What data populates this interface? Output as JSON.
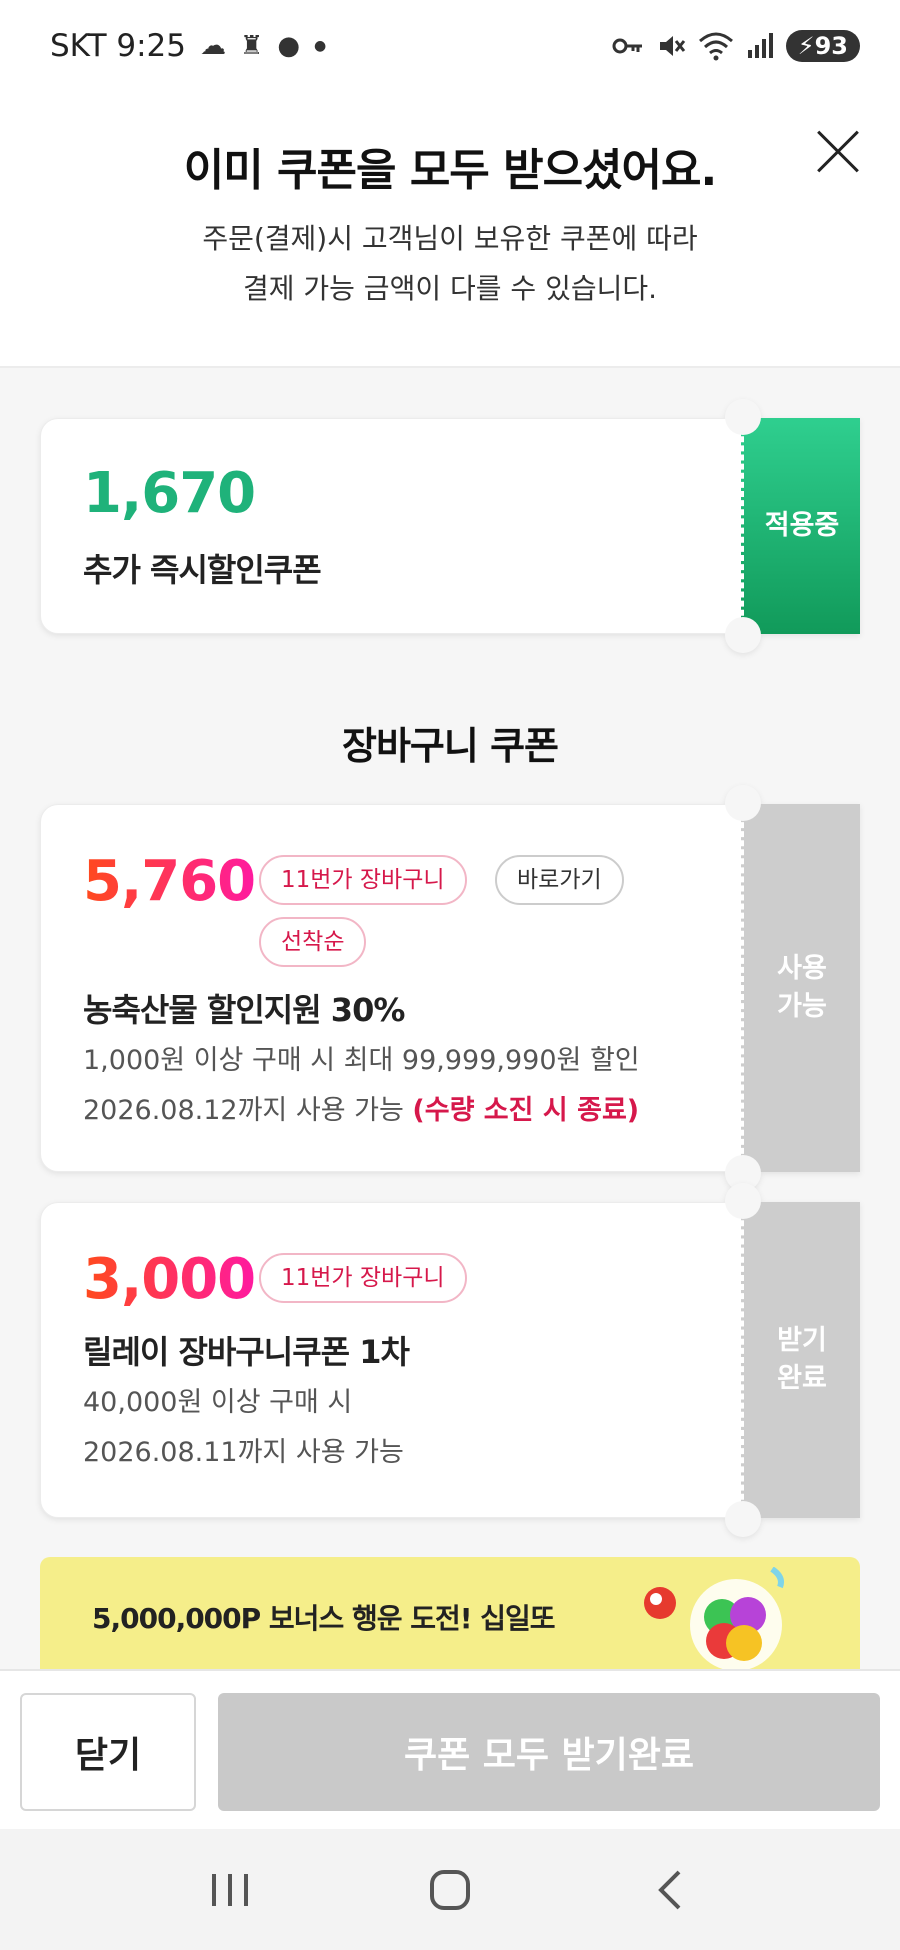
{
  "status_bar": {
    "carrier_time": "SKT 9:25",
    "battery": "93",
    "icons_left": [
      "cloud-icon",
      "app-icon",
      "chat-icon",
      "dot-icon"
    ],
    "icons_right": [
      "key-icon",
      "mute-icon",
      "wifi-icon",
      "signal-icon",
      "battery-icon"
    ]
  },
  "header": {
    "title": "이미 쿠폰을 모두 받으셨어요.",
    "desc_line1": "주문(결제)시 고객님이 보유한 쿠폰에 따라",
    "desc_line2": "결제 가능 금액이 다를 수 있습니다."
  },
  "instant_coupon": {
    "amount": "1,670",
    "name": "추가 즉시할인쿠폰",
    "status": "적용중"
  },
  "section_title": "장바구니 쿠폰",
  "cart_coupons": [
    {
      "amount": "5,760",
      "tags": [
        "11번가 장바구니",
        "선착순"
      ],
      "link_label": "바로가기",
      "name": "농축산물 할인지원 30%",
      "condition": "1,000원 이상 구매 시 최대 99,999,990원 할인",
      "expiry": "2026.08.12까지 사용 가능",
      "note": "(수량 소진 시 종료)",
      "status_line1": "사용",
      "status_line2": "가능"
    },
    {
      "amount": "3,000",
      "tags": [
        "11번가 장바구니"
      ],
      "name": "릴레이 장바구니쿠폰 1차",
      "condition": "40,000원 이상 구매 시",
      "expiry": "2026.08.11까지 사용 가능",
      "status_line1": "받기",
      "status_line2": "완료"
    }
  ],
  "banner": {
    "text": "5,000,000P 보너스 행운 도전! 십일또"
  },
  "bottom_bar": {
    "close_label": "닫기",
    "all_label": "쿠폰 모두 받기완료"
  },
  "colors": {
    "green": "#1fb27a",
    "accent_red": "#ff4a1c",
    "accent_pink": "#ff1aa0",
    "note_red": "#d6184b",
    "disabled_gray": "#c9c9c9",
    "banner_yellow": "#f5ee8a"
  }
}
